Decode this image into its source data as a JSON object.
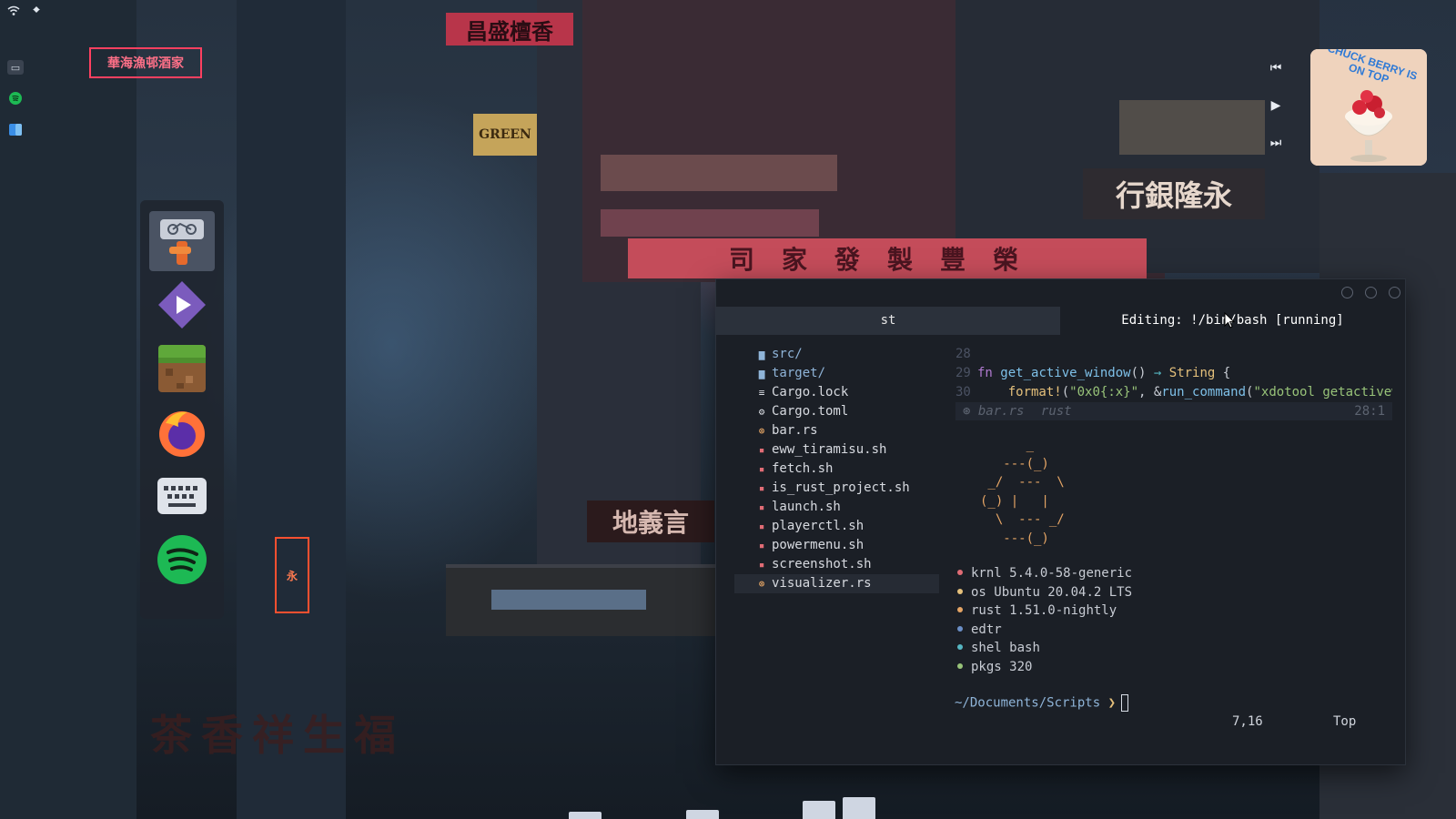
{
  "colors": {
    "terminal_bg": "#1b1f26",
    "tab_inactive_bg": "#2b313b",
    "accent_orange": "#e5a565",
    "spotify_green": "#1db954",
    "dot_colors": [
      "#e06c75",
      "#e5c07b",
      "#e5a565",
      "#6b8fc7",
      "#56b6c2",
      "#98c379"
    ]
  },
  "tray": {
    "wifi_icon": "wifi-icon",
    "menu_icon": "chevron-down-icon",
    "mini_icons": [
      "terminal-mini-icon",
      "spotify-mini-icon",
      "finder-mini-icon"
    ]
  },
  "dock": {
    "items": [
      {
        "name": "cycling-app",
        "active": true
      },
      {
        "name": "stremio-app"
      },
      {
        "name": "minecraft-app"
      },
      {
        "name": "firefox-app"
      },
      {
        "name": "keyboard-app"
      },
      {
        "name": "spotify-app"
      }
    ]
  },
  "music": {
    "prev_icon": "⏮",
    "play_icon": "▶",
    "next_icon": "⏭",
    "album_text": "CHUCK BERRY IS ON TOP"
  },
  "terminal": {
    "tabs": [
      {
        "label": "st"
      },
      {
        "label": "Editing: !/bin/bash [running]"
      }
    ],
    "tree": [
      {
        "icon": "▆",
        "name": "src/",
        "type": "dir"
      },
      {
        "icon": "▆",
        "name": "target/",
        "type": "dir"
      },
      {
        "icon": "≡",
        "name": "Cargo.lock",
        "type": "file"
      },
      {
        "icon": "⚙",
        "name": "Cargo.toml",
        "type": "file"
      },
      {
        "icon": "⊛",
        "name": "bar.rs",
        "type": "file"
      },
      {
        "icon": "▪",
        "name": "eww_tiramisu.sh",
        "type": "file"
      },
      {
        "icon": "▪",
        "name": "fetch.sh",
        "type": "file"
      },
      {
        "icon": "▪",
        "name": "is_rust_project.sh",
        "type": "file"
      },
      {
        "icon": "▪",
        "name": "launch.sh",
        "type": "file"
      },
      {
        "icon": "▪",
        "name": "playerctl.sh",
        "type": "file"
      },
      {
        "icon": "▪",
        "name": "powermenu.sh",
        "type": "file"
      },
      {
        "icon": "▪",
        "name": "screenshot.sh",
        "type": "file"
      },
      {
        "icon": "⊛",
        "name": "visualizer.rs",
        "type": "file",
        "selected": true
      }
    ],
    "editor": {
      "lines": [
        {
          "num": "28",
          "code": ""
        },
        {
          "num": "29",
          "kw": "fn ",
          "fn": "get_active_window",
          "rest1": "() ",
          "op": "→",
          "rest2": " ",
          "ty": "String",
          "rest3": " {"
        },
        {
          "num": "30",
          "indent": "    ",
          "fn": "format!",
          "rest1": "(",
          "str1": "\"0x0{:x}\"",
          "rest2": ", &",
          "fn2": "run_command",
          "rest3": "(",
          "str2": "\"xdotool getactivew"
        }
      ],
      "status_file": "bar.rs",
      "status_lang": "rust",
      "status_pos": "28:1",
      "status_icon": "⊛"
    },
    "ascii_art": "      _\n   ---(_)\n _/  ---  \\\n(_) |   |\n  \\  --- _/\n   ---(_)",
    "fetch": [
      {
        "key": "krnl",
        "value": "5.4.0-58-generic"
      },
      {
        "key": "os",
        "value": "Ubuntu 20.04.2 LTS"
      },
      {
        "key": "rust",
        "value": "1.51.0-nightly"
      },
      {
        "key": "edtr",
        "value": ""
      },
      {
        "key": "shel",
        "value": "bash"
      },
      {
        "key": "pkgs",
        "value": "320"
      }
    ],
    "prompt_path": "~/Documents/Scripts",
    "prompt_symbol": "❯",
    "cursor_pos": "7,16",
    "scroll_pos": "Top"
  }
}
